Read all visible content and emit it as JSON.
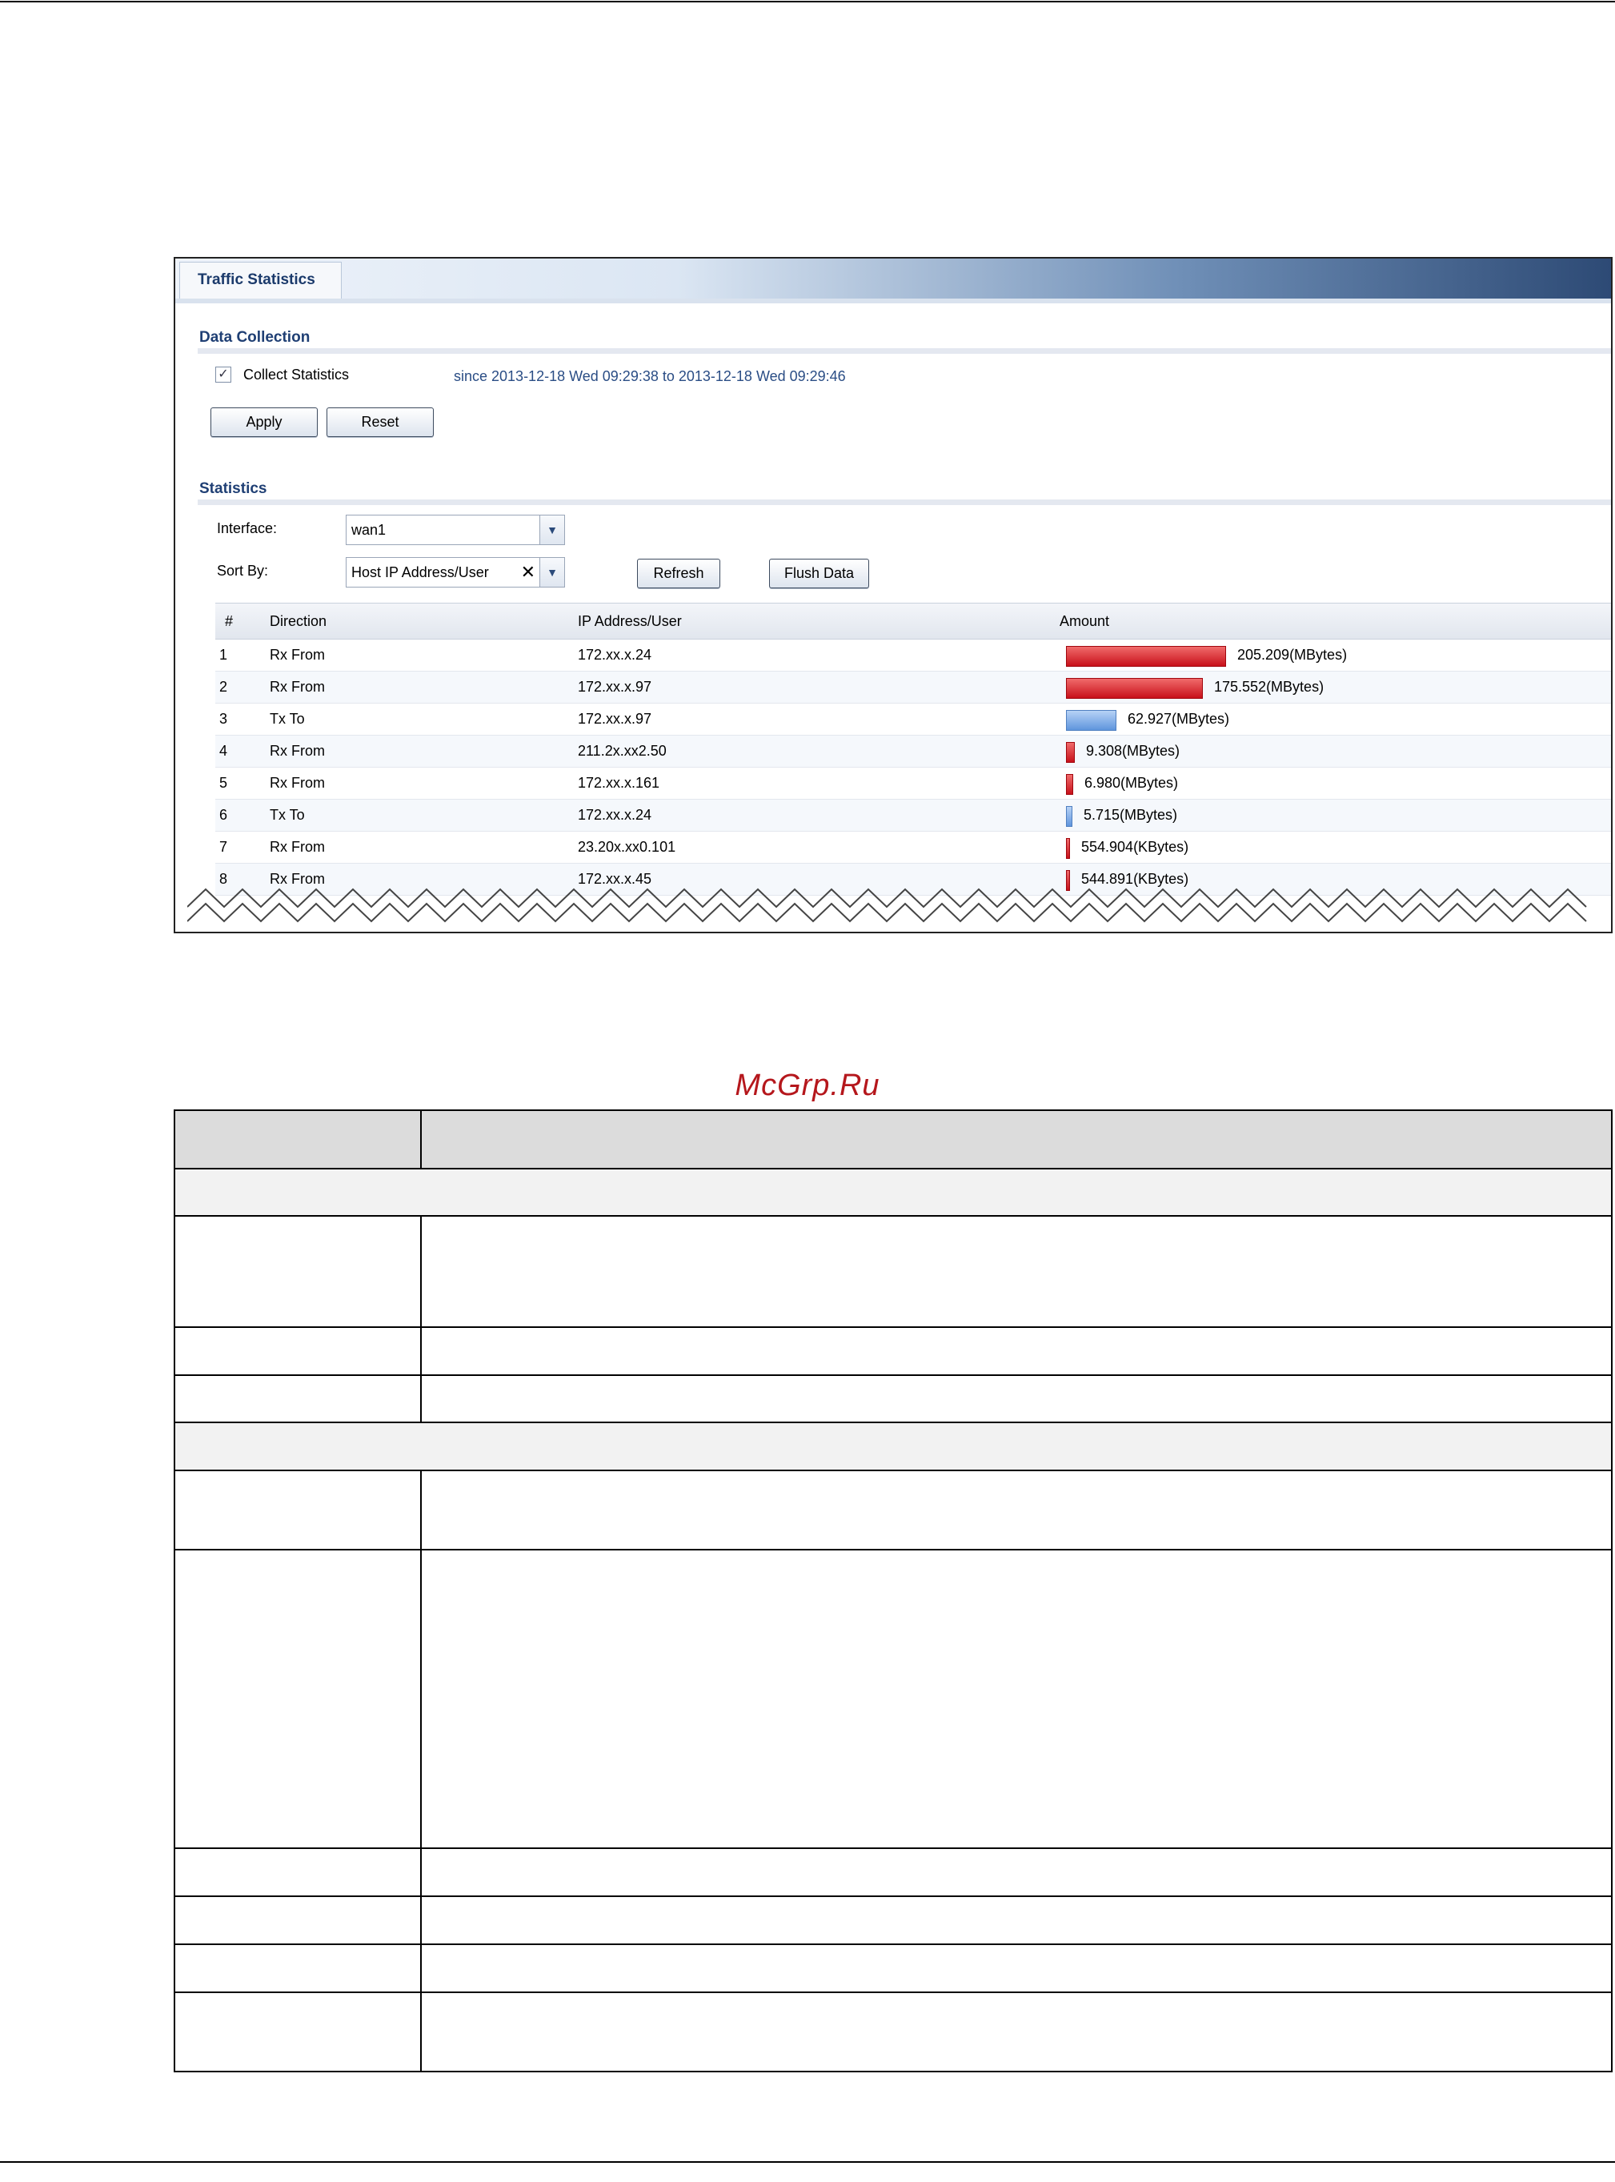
{
  "screenshot": {
    "tab_label": "Traffic Statistics",
    "data_collection": {
      "title": "Data Collection",
      "collect_label": "Collect Statistics",
      "collect_checked": true,
      "since_text": "since 2013-12-18 Wed 09:29:38 to 2013-12-18 Wed 09:29:46",
      "apply_label": "Apply",
      "reset_label": "Reset"
    },
    "statistics": {
      "title": "Statistics",
      "interface_label": "Interface:",
      "interface_value": "wan1",
      "sortby_label": "Sort By:",
      "sortby_value": "Host IP Address/User",
      "refresh_label": "Refresh",
      "flush_label": "Flush Data",
      "columns": [
        "#",
        "Direction",
        "IP Address/User",
        "Amount"
      ],
      "rows": [
        {
          "num": "1",
          "direction": "Rx From",
          "ip": "172.xx.x.24",
          "amount": "205.209(MBytes)",
          "kind": "rx",
          "fraction": 1.0
        },
        {
          "num": "2",
          "direction": "Rx From",
          "ip": "172.xx.x.97",
          "amount": "175.552(MBytes)",
          "kind": "rx",
          "fraction": 0.855
        },
        {
          "num": "3",
          "direction": "Tx To",
          "ip": "172.xx.x.97",
          "amount": "62.927(MBytes)",
          "kind": "tx",
          "fraction": 0.307
        },
        {
          "num": "4",
          "direction": "Rx From",
          "ip": "211.2x.xx2.50",
          "amount": "9.308(MBytes)",
          "kind": "rx",
          "fraction": 0.045
        },
        {
          "num": "5",
          "direction": "Rx From",
          "ip": "172.xx.x.161",
          "amount": "6.980(MBytes)",
          "kind": "rx",
          "fraction": 0.034
        },
        {
          "num": "6",
          "direction": "Tx To",
          "ip": "172.xx.x.24",
          "amount": "5.715(MBytes)",
          "kind": "tx",
          "fraction": 0.028
        },
        {
          "num": "7",
          "direction": "Rx From",
          "ip": "23.20x.xx0.101",
          "amount": "554.904(KBytes)",
          "kind": "rx",
          "fraction": 0.003
        },
        {
          "num": "8",
          "direction": "Rx From",
          "ip": "172.xx.x.45",
          "amount": "544.891(KBytes)",
          "kind": "rx",
          "fraction": 0.003
        }
      ]
    }
  },
  "watermark": "McGrp.Ru"
}
